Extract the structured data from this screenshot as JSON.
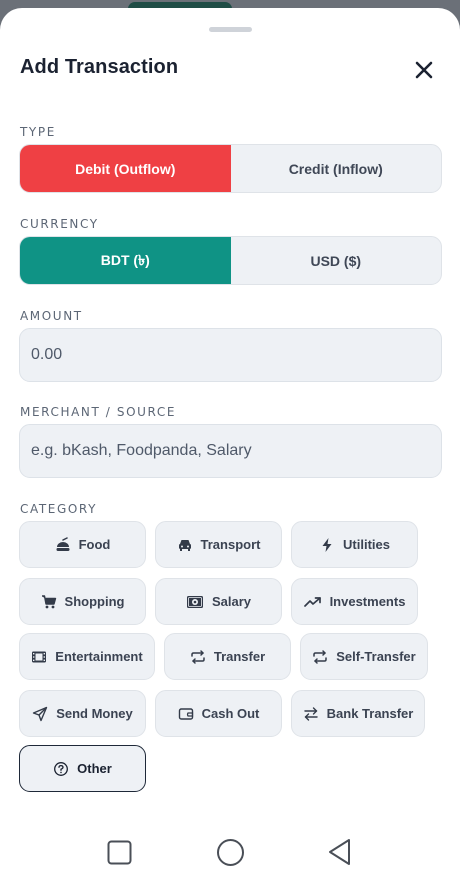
{
  "header": {
    "title": "Add Transaction",
    "close_icon": "close-icon"
  },
  "type": {
    "label": "TYPE",
    "options": [
      "Debit (Outflow)",
      "Credit (Inflow)"
    ],
    "selected": "Debit (Outflow)",
    "selected_color": "#ef4044"
  },
  "currency": {
    "label": "CURRENCY",
    "options": [
      "BDT (৳)",
      "USD ($)"
    ],
    "selected": "BDT (৳)",
    "selected_color": "#0f9385"
  },
  "amount": {
    "label": "AMOUNT",
    "value": "0.00"
  },
  "merchant": {
    "label": "MERCHANT / SOURCE",
    "placeholder": "e.g. bKash, Foodpanda, Salary"
  },
  "category": {
    "label": "CATEGORY",
    "selected": "Other",
    "items": [
      {
        "label": "Food",
        "icon": "food-icon"
      },
      {
        "label": "Transport",
        "icon": "car-icon"
      },
      {
        "label": "Utilities",
        "icon": "bolt-icon"
      },
      {
        "label": "Shopping",
        "icon": "cart-icon"
      },
      {
        "label": "Salary",
        "icon": "cash-icon"
      },
      {
        "label": "Investments",
        "icon": "trending-up-icon"
      },
      {
        "label": "Entertainment",
        "icon": "film-icon"
      },
      {
        "label": "Transfer",
        "icon": "repeat-icon"
      },
      {
        "label": "Self-Transfer",
        "icon": "repeat-icon"
      },
      {
        "label": "Send Money",
        "icon": "send-icon"
      },
      {
        "label": "Cash Out",
        "icon": "wallet-icon"
      },
      {
        "label": "Bank Transfer",
        "icon": "swap-icon"
      },
      {
        "label": "Other",
        "icon": "help-circle-icon"
      }
    ]
  },
  "navbar": {
    "icons": [
      "recents-square-icon",
      "home-circle-icon",
      "back-triangle-icon"
    ]
  }
}
